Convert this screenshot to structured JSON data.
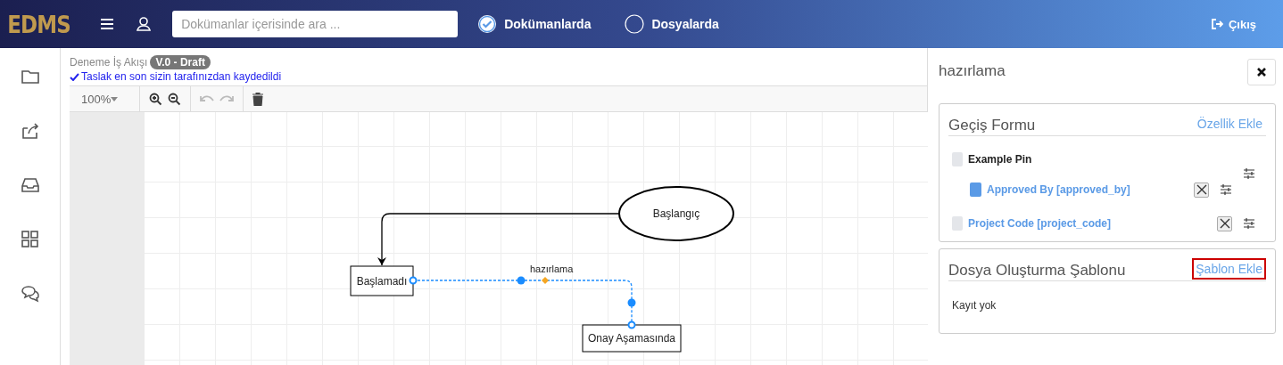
{
  "header": {
    "logo": "EDMS",
    "search": {
      "placeholder": "Dokümanlar içerisinde ara ..."
    },
    "scope": [
      {
        "label": "Dokümanlarda",
        "selected": true
      },
      {
        "label": "Dosyalarda",
        "selected": false
      }
    ],
    "logout": "Çıkış"
  },
  "document": {
    "title": "Deneme İş Akışı",
    "version": "V.0 - Draft",
    "status": "Taslak en son sizin tarafınızdan kaydedildi"
  },
  "toolbar": {
    "zoom": "100%"
  },
  "diagram": {
    "nodes": [
      {
        "kind": "ellipse",
        "label": "Başlangıç"
      },
      {
        "kind": "rect",
        "label": "Başlamadı"
      },
      {
        "kind": "rect",
        "label": "Onay Aşamasında"
      }
    ],
    "edges": [
      {
        "label": "hazırlama",
        "selected": true
      }
    ]
  },
  "panel": {
    "title": "hazırlama",
    "form": {
      "title": "Geçiş Formu",
      "action": "Özellik Ekle",
      "items": [
        {
          "label": "Example Pin",
          "checked": false,
          "children": [
            {
              "label": "Approved By [approved_by]",
              "checked": true
            }
          ]
        },
        {
          "label": "Project Code [project_code]",
          "checked": false
        }
      ]
    },
    "template": {
      "title": "Dosya Oluşturma Şablonu",
      "action": "Şablon Ekle",
      "highlighted": true,
      "empty": "Kayıt yok"
    }
  }
}
